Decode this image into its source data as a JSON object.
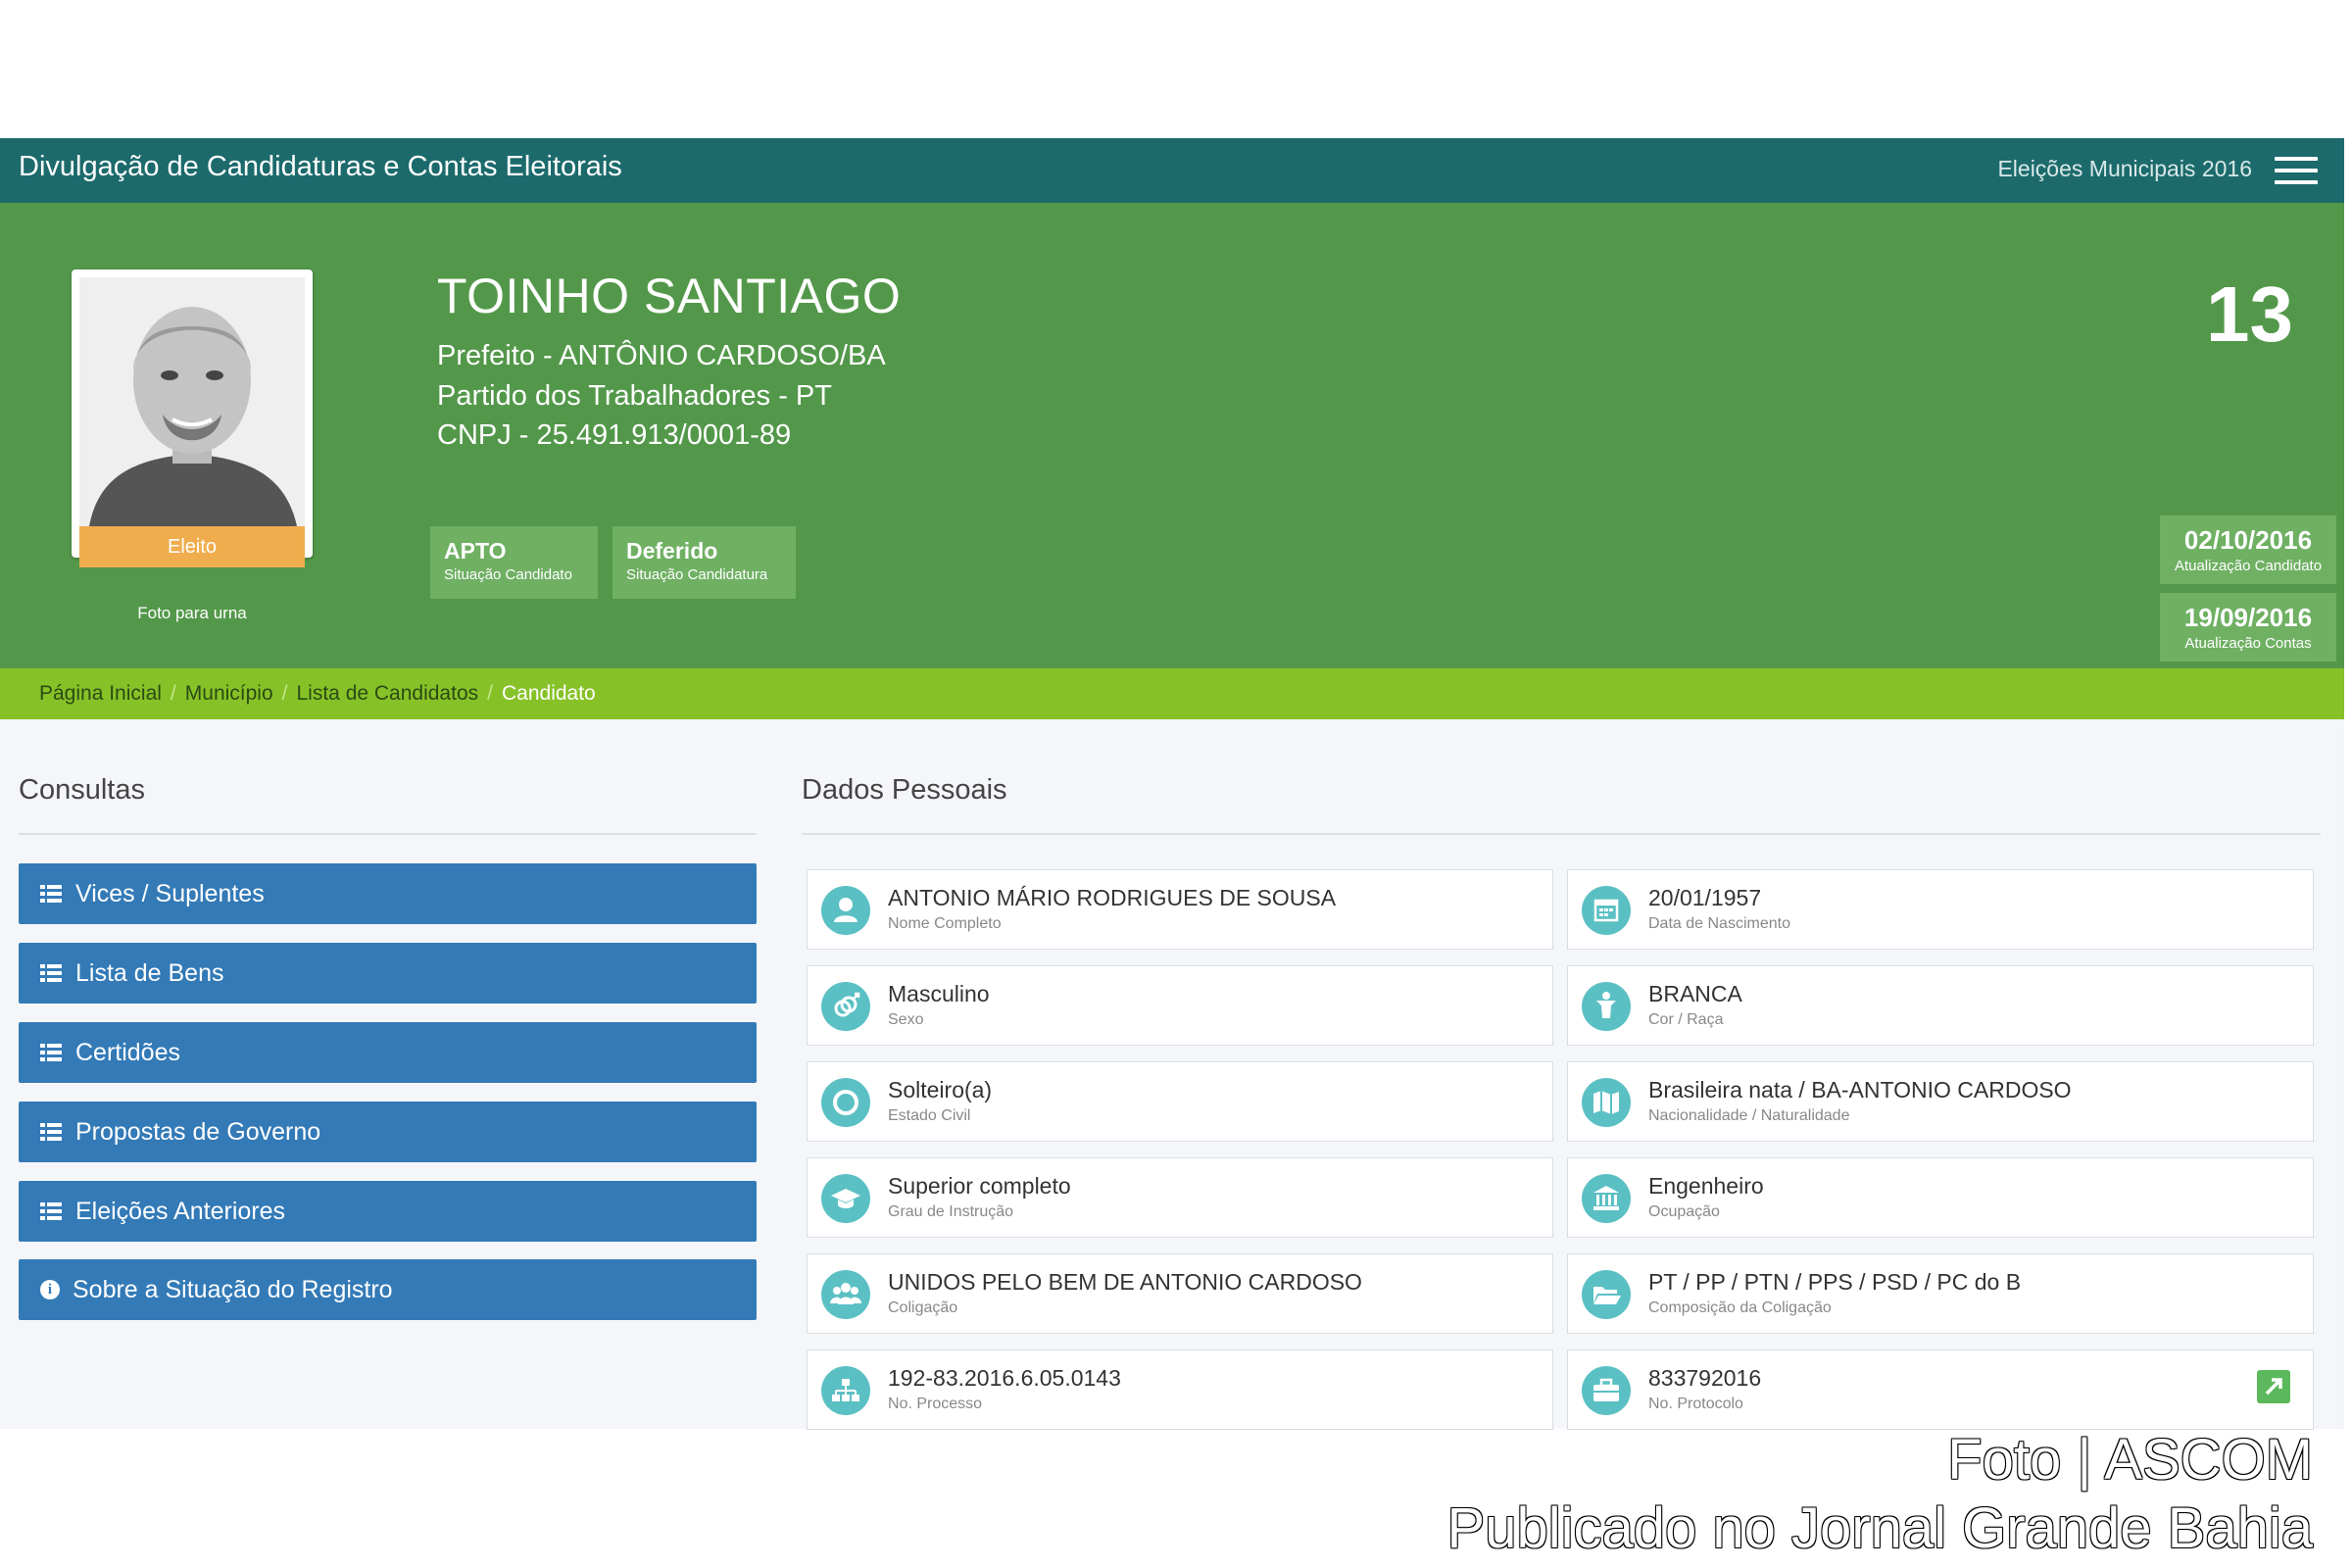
{
  "header": {
    "app_title": "Divulgação de Candidaturas e Contas Eleitorais",
    "election": "Eleições Municipais 2016",
    "menu_icon": "hamburger-menu-icon"
  },
  "candidate": {
    "name": "TOINHO SANTIAGO",
    "office": "Prefeito - ANTÔNIO CARDOSO/BA",
    "party": "Partido dos Trabalhadores - PT",
    "cnpj": "CNPJ - 25.491.913/0001-89",
    "number": "13",
    "photo_badge": "Eleito",
    "photo_caption": "Foto para urna"
  },
  "status": [
    {
      "value": "APTO",
      "label": "Situação Candidato"
    },
    {
      "value": "Deferido",
      "label": "Situação Candidatura"
    }
  ],
  "updates": [
    {
      "value": "02/10/2016",
      "label": "Atualização Candidato"
    },
    {
      "value": "19/09/2016",
      "label": "Atualização Contas"
    }
  ],
  "breadcrumb": [
    "Página Inicial",
    "Município",
    "Lista de Candidatos",
    "Candidato"
  ],
  "consultas": {
    "title": "Consultas",
    "buttons": [
      {
        "label": "Vices / Suplentes",
        "icon": "list-icon"
      },
      {
        "label": "Lista de Bens",
        "icon": "list-icon"
      },
      {
        "label": "Certidões",
        "icon": "list-icon"
      },
      {
        "label": "Propostas de Governo",
        "icon": "list-icon"
      },
      {
        "label": "Eleições Anteriores",
        "icon": "list-icon"
      },
      {
        "label": "Sobre a Situação do Registro",
        "icon": "info-icon"
      }
    ]
  },
  "dados": {
    "title": "Dados Pessoais",
    "items": [
      {
        "value": "ANTONIO MÁRIO RODRIGUES DE SOUSA",
        "label": "Nome Completo",
        "icon": "user-icon"
      },
      {
        "value": "20/01/1957",
        "label": "Data de Nascimento",
        "icon": "calendar-icon"
      },
      {
        "value": "Masculino",
        "label": "Sexo",
        "icon": "gender-icon"
      },
      {
        "value": "BRANCA",
        "label": "Cor / Raça",
        "icon": "person-icon"
      },
      {
        "value": "Solteiro(a)",
        "label": "Estado Civil",
        "icon": "ring-icon"
      },
      {
        "value": "Brasileira nata / BA-ANTONIO CARDOSO",
        "label": "Nacionalidade / Naturalidade",
        "icon": "map-icon"
      },
      {
        "value": "Superior completo",
        "label": "Grau de Instrução",
        "icon": "graduation-cap-icon"
      },
      {
        "value": "Engenheiro",
        "label": "Ocupação",
        "icon": "institution-icon"
      },
      {
        "value": "UNIDOS PELO BEM DE ANTONIO CARDOSO",
        "label": "Coligação",
        "icon": "group-icon"
      },
      {
        "value": "PT / PP / PTN / PPS / PSD / PC do B",
        "label": "Composição da Coligação",
        "icon": "folder-icon"
      },
      {
        "value": "192-83.2016.6.05.0143",
        "label": "No. Processo",
        "icon": "sitemap-icon"
      },
      {
        "value": "833792016",
        "label": "No. Protocolo",
        "icon": "briefcase-icon"
      }
    ]
  },
  "watermark": {
    "line1": "Foto | ASCOM",
    "line2": "Publicado no Jornal Grande Bahia"
  },
  "colors": {
    "topbar": "#1c6a6c",
    "hero": "#53984a",
    "breadcrumb": "#86c227",
    "button": "#337ab7",
    "badge": "#f0ad4e",
    "icon_circle": "#5bc0c4"
  }
}
